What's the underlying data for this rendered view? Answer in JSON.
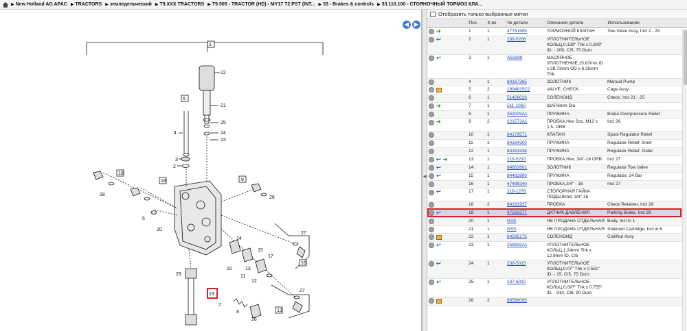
{
  "breadcrumb": {
    "items": [
      "New Holland AG APAC",
      "TRACTORS",
      "земледельческий",
      "T9.XXX TRACTORS",
      "T9.505 - TRACTOR (HD) - MY17 T2 PST (INT...",
      "33 - Brakes & controls",
      "33.110.100 - СТОЯНОЧНЫЙ ТОРМОЗ КЛА..."
    ]
  },
  "diagram": {
    "callouts": [
      "1",
      "22",
      "6",
      "21",
      "25",
      "4",
      "24",
      "23",
      "3",
      "2",
      "18",
      "18",
      "9",
      "28",
      "26",
      "5",
      "20",
      "14",
      "15",
      "17",
      "27",
      "16",
      "10",
      "13",
      "11",
      "12",
      "29",
      "19",
      "7",
      "8",
      "26",
      "27",
      "13",
      "16"
    ]
  },
  "panel": {
    "filter_label": "Отобразить только выбранные метки",
    "columns": [
      "",
      "Поз.",
      "К-во",
      "№ детали",
      "Описание детали",
      "Использование"
    ]
  },
  "rows": [
    {
      "icons": [
        "info",
        "arrowg"
      ],
      "pos": "1",
      "qty": "1",
      "part": "47781505",
      "desc": "ТОРМОЗНОЙ КЛАПАН",
      "use": "Tow Valve Assy, Incl 2 - 29"
    },
    {
      "icons": [
        "info",
        "arrowb"
      ],
      "pos": "2",
      "qty": "1",
      "part": "238-5206",
      "desc": "УПЛОТНИТЕЛЬНОЕ КОЛЬЦ,0.139\" Thk x 0.609\" ID, - 208, CI5, 75 Duro",
      "use": ""
    },
    {
      "icons": [
        "info",
        "arrowb"
      ],
      "pos": "3",
      "qty": "1",
      "part": "A63399",
      "desc": "МАСЛЯНОЕ УПЛОТНЕНИЕ,15.87mm ID x 28.73mm OD x 6.35mm Thk",
      "use": ""
    },
    {
      "icons": [
        "info"
      ],
      "pos": "4",
      "qty": "1",
      "part": "84187365",
      "desc": "ЗОЛОТНИК",
      "use": "Manual Pump"
    },
    {
      "icons": [
        "info",
        "box"
      ],
      "pos": "5",
      "qty": "2",
      "part": "1994615C2",
      "desc": "VALVE, CHECK",
      "use": "Cage Assy"
    },
    {
      "icons": [
        "info"
      ],
      "pos": "6",
      "qty": "1",
      "part": "51426026",
      "desc": "СОЛЕНОИД",
      "use": "Check, Incl 21 - 25"
    },
    {
      "icons": [
        "info",
        "arrowg"
      ],
      "pos": "7",
      "qty": "1",
      "part": "511-1060",
      "desc": "ШАР,6mm Dia",
      "use": ""
    },
    {
      "icons": [
        "info"
      ],
      "pos": "8",
      "qty": "1",
      "part": "352025A1",
      "desc": "ПРУЖИНА",
      "use": "Brake Overpressure Relief"
    },
    {
      "icons": [
        "info",
        "arrowg"
      ],
      "pos": "9",
      "qty": "2",
      "part": "221573A1",
      "desc": "ПРОБКА,Hex Soc, M12 x 1.5, ORB",
      "use": "Incl 26"
    },
    {
      "icons": [
        "info"
      ],
      "pos": "10",
      "qty": "1",
      "part": "84179571",
      "desc": "КЛАПАН",
      "use": "Spool Regulator Relief"
    },
    {
      "icons": [
        "info"
      ],
      "pos": "11",
      "qty": "1",
      "part": "84184300",
      "desc": "ПРУЖИНА",
      "use": "Regulator Relief, Inner"
    },
    {
      "icons": [
        "info"
      ],
      "pos": "12",
      "qty": "1",
      "part": "84181936",
      "desc": "ПРУЖИНА",
      "use": "Regulator Relief, Outer"
    },
    {
      "icons": [
        "info",
        "arrowb",
        "arrowg"
      ],
      "pos": "13",
      "qty": "1",
      "part": "218-5210",
      "desc": "ПРОБКА,Hex, 3/4\"-16 ORB",
      "use": "Incl 27"
    },
    {
      "icons": [
        "info",
        "arrowb"
      ],
      "pos": "14",
      "qty": "1",
      "part": "84602601",
      "desc": "ЗОЛОТНИК",
      "use": "Regulator Tow Valve"
    },
    {
      "icons": [
        "info",
        "arrowb"
      ],
      "pos": "15",
      "qty": "1",
      "part": "84482890",
      "desc": "ПРУЖИНА",
      "use": "Regulator, 24 Bar"
    },
    {
      "icons": [
        "info"
      ],
      "pos": "16",
      "qty": "1",
      "part": "47488340",
      "desc": "ПРОБКА,3/4\" - 16",
      "use": "Incl 27"
    },
    {
      "icons": [
        "info",
        "arrowb"
      ],
      "pos": "17",
      "qty": "1",
      "part": "218-1278",
      "desc": "СТОПОРНАЯ ГАЙКА ПОДШ,8khd, 3/4\"-16",
      "use": ""
    },
    {
      "icons": [
        "info"
      ],
      "pos": "18",
      "qty": "2",
      "part": "84181937",
      "desc": "ПРОБКА",
      "use": "Check Retainer, Incl 28"
    },
    {
      "icons": [
        "info",
        "arrowb"
      ],
      "pos": "19",
      "qty": "1",
      "part": "47569377",
      "desc": "ДАТЧИК ДАВЛЕНИЯ",
      "use": "Parking Brake, Incl 29",
      "selected": true
    },
    {
      "icons": [
        "info"
      ],
      "pos": "20",
      "qty": "1",
      "part": "NSS",
      "desc": "НЕ ПРОДАНА ОТДЕЛЬНАЯ",
      "use": "Body, Incl in 1"
    },
    {
      "icons": [
        "info"
      ],
      "pos": "21",
      "qty": "1",
      "part": "NSS",
      "desc": "НЕ ПРОДАНА ОТДЕЛЬНАЯ",
      "use": "Solenoid Cartridge, Incl in 6"
    },
    {
      "icons": [
        "info",
        "box"
      ],
      "pos": "22",
      "qty": "1",
      "part": "84595175",
      "desc": "СОЛЕНОИД",
      "use": "Coil/Nut Assy"
    },
    {
      "icons": [
        "info",
        "arrowb"
      ],
      "pos": "23",
      "qty": "1",
      "part": "258833A1",
      "desc": "УПЛОТНИТЕЛЬНОЕ КОЛЬЦ,1.24mm Thk x 12.9mm ID, CI5",
      "use": ""
    },
    {
      "icons": [
        "info",
        "arrowb"
      ],
      "pos": "24",
      "qty": "1",
      "part": "238-5015",
      "desc": "УПЛОТНИТЕЛЬНОЕ КОЛЬЦ,0.07\" Thk x 0.551\" ID, - 15, CI5, 75 Duro",
      "use": ""
    },
    {
      "icons": [
        "info",
        "arrowb"
      ],
      "pos": "25",
      "qty": "1",
      "part": "237-6010",
      "desc": "УПЛОТНИТЕЛЬНОЕ КОЛЬЦ,0.097\" Thk x 0.755\" ID, - 910, CI6, 90 Duro",
      "use": ""
    },
    {
      "icons": [
        "info",
        "box"
      ],
      "pos": "26",
      "qty": "2",
      "part": "86598095",
      "desc": "",
      "use": ""
    }
  ]
}
